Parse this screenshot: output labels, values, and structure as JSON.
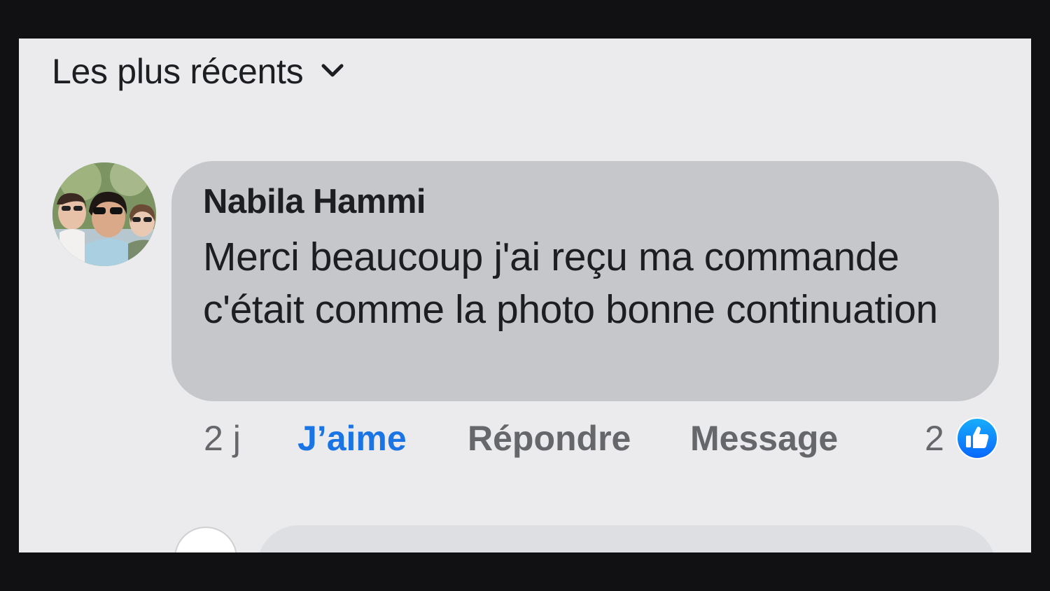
{
  "sort": {
    "label": "Les plus récents",
    "icon": "chevron-down-icon"
  },
  "comment": {
    "author": "Nabila Hammi",
    "text": "Merci beaucoup j'ai reçu ma commande c'était comme la photo bonne continuation",
    "time": "2 j",
    "like_label": "J’aime",
    "reply_label": "Répondre",
    "message_label": "Message",
    "reaction_count": "2",
    "reaction_icon": "thumbs-up-icon"
  },
  "colors": {
    "like_blue": "#1b74e4",
    "bubble_gray": "#c6c7cb",
    "screen_bg": "#ebebed"
  }
}
